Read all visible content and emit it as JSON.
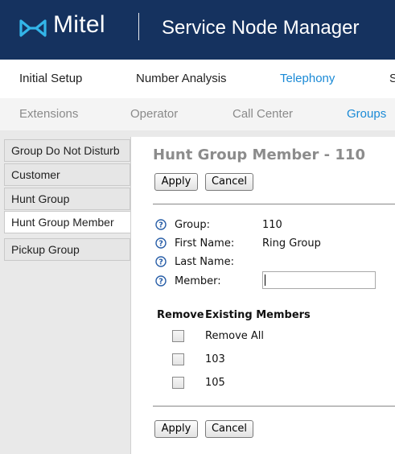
{
  "header": {
    "brand": "Mitel",
    "app_title": "Service Node Manager"
  },
  "nav_primary": [
    {
      "label": "Initial Setup",
      "active": false
    },
    {
      "label": "Number Analysis",
      "active": false
    },
    {
      "label": "Telephony",
      "active": true
    },
    {
      "label": "S",
      "active": false
    }
  ],
  "nav_secondary": [
    {
      "label": "Extensions",
      "active": false
    },
    {
      "label": "Operator",
      "active": false
    },
    {
      "label": "Call Center",
      "active": false
    },
    {
      "label": "Groups",
      "active": true
    }
  ],
  "sidebar": {
    "items": [
      {
        "label": "Group Do Not Disturb",
        "active": false
      },
      {
        "label": "Customer",
        "active": false
      },
      {
        "label": "Hunt Group",
        "active": false
      },
      {
        "label": "Hunt Group Member",
        "active": true
      },
      {
        "label": "Pickup Group",
        "active": false
      }
    ]
  },
  "main": {
    "title": "Hunt Group Member - 110",
    "apply_label": "Apply",
    "cancel_label": "Cancel",
    "fields": [
      {
        "label": "Group:",
        "value": "110"
      },
      {
        "label": "First Name:",
        "value": "Ring Group"
      },
      {
        "label": "Last Name:",
        "value": ""
      },
      {
        "label": "Member:",
        "value": ""
      }
    ],
    "member_input_value": "",
    "table": {
      "col_remove": "Remove",
      "col_members": "Existing Members",
      "rows": [
        {
          "label": "Remove All",
          "checked": false
        },
        {
          "label": "103",
          "checked": false
        },
        {
          "label": "105",
          "checked": false
        }
      ]
    }
  },
  "colors": {
    "header_bg": "#15325f",
    "accent": "#1a8ad6",
    "help_icon": "#2a5fa8"
  },
  "icons": {
    "logo": "mitel-logo-icon",
    "help": "help-icon"
  }
}
